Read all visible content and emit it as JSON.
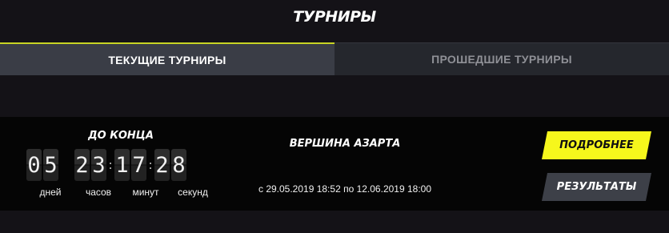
{
  "page": {
    "title": "ТУРНИРЫ"
  },
  "tabs": [
    {
      "label": "ТЕКУЩИЕ ТУРНИРЫ",
      "active": true
    },
    {
      "label": "ПРОШЕДШИЕ ТУРНИРЫ",
      "active": false
    }
  ],
  "tournament": {
    "until_label": "ДО КОНЦА",
    "countdown": {
      "days": [
        "0",
        "5"
      ],
      "hours": [
        "2",
        "3"
      ],
      "minutes": [
        "1",
        "7"
      ],
      "seconds": [
        "2",
        "8"
      ],
      "separator": ":"
    },
    "unit_labels": {
      "days": "дней",
      "hours": "часов",
      "minutes": "минут",
      "seconds": "секунд"
    },
    "name": "ВЕРШИНА АЗАРТА",
    "date_range": "с 29.05.2019 18:52 по 12.06.2019 18:00",
    "buttons": {
      "details": "ПОДРОБНЕЕ",
      "results": "РЕЗУЛЬТАТЫ"
    }
  },
  "colors": {
    "background": "#141217",
    "accent": "#f6f71c",
    "active_tab": "#3a3d46",
    "inactive_tab": "#25272d",
    "card": "#050505",
    "secondary_button": "#3d4048"
  }
}
